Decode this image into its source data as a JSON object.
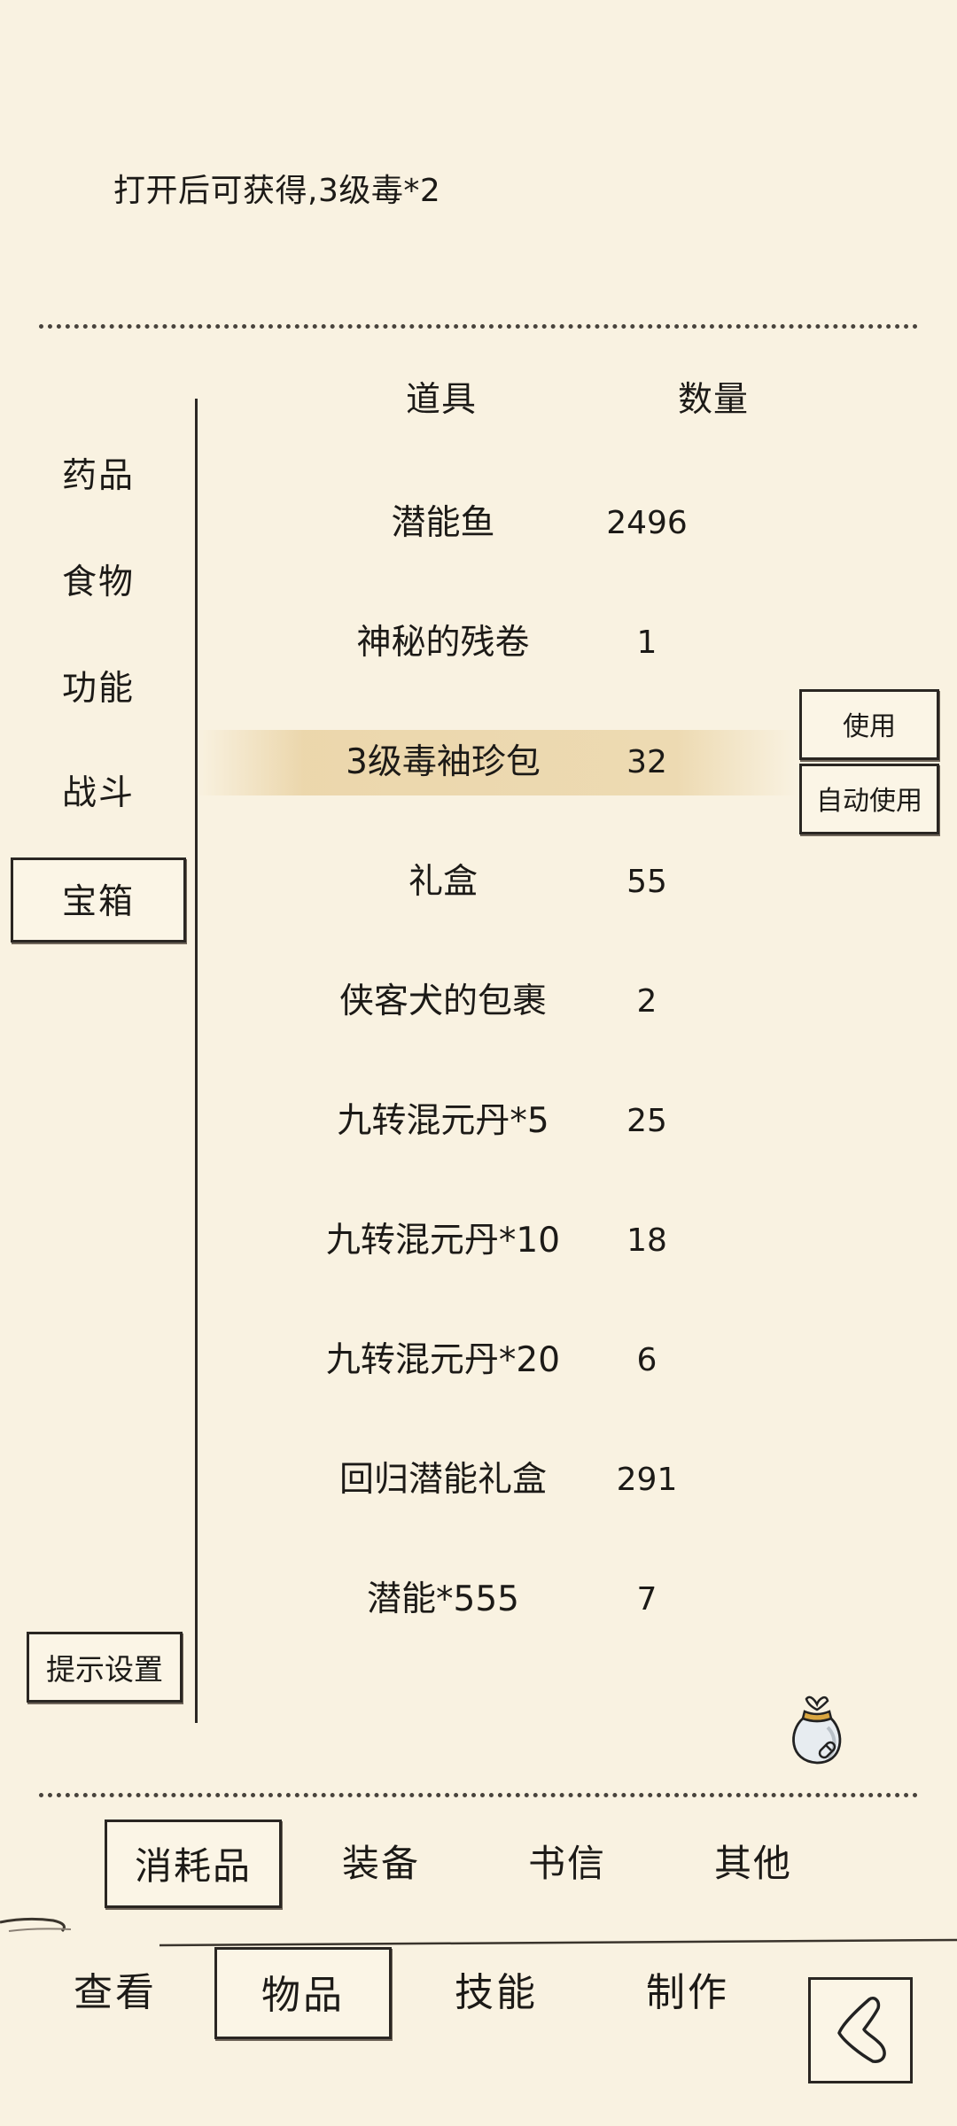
{
  "description": "打开后可获得,3级毒*2",
  "categories": [
    {
      "label": "药品"
    },
    {
      "label": "食物"
    },
    {
      "label": "功能"
    },
    {
      "label": "战斗"
    },
    {
      "label": "宝箱"
    }
  ],
  "selected_category": "宝箱",
  "hint_settings_label": "提示设置",
  "table": {
    "header_item": "道具",
    "header_qty": "数量",
    "rows": [
      {
        "name": "潜能鱼",
        "qty": "2496"
      },
      {
        "name": "神秘的残卷",
        "qty": "1"
      },
      {
        "name": "3级毒袖珍包",
        "qty": "32"
      },
      {
        "name": "礼盒",
        "qty": "55"
      },
      {
        "name": "侠客犬的包裹",
        "qty": "2"
      },
      {
        "name": "九转混元丹*5",
        "qty": "25"
      },
      {
        "name": "九转混元丹*10",
        "qty": "18"
      },
      {
        "name": "九转混元丹*20",
        "qty": "6"
      },
      {
        "name": "回归潜能礼盒",
        "qty": "291"
      },
      {
        "name": "潜能*555",
        "qty": "7"
      }
    ],
    "selected_row": "3级毒袖珍包"
  },
  "actions": {
    "use_label": "使用",
    "auto_use_label": "自动使用"
  },
  "icons": {
    "bag": "bag-icon",
    "back": "back-icon"
  },
  "sub_tabs": [
    {
      "label": "消耗品"
    },
    {
      "label": "装备"
    },
    {
      "label": "书信"
    },
    {
      "label": "其他"
    }
  ],
  "selected_sub_tab": "消耗品",
  "bottom_nav": [
    {
      "label": "查看"
    },
    {
      "label": "物品"
    },
    {
      "label": "技能"
    },
    {
      "label": "制作"
    }
  ],
  "selected_nav": "物品",
  "colors": {
    "background": "#f9f2e1",
    "ink": "#1c1a17",
    "highlight": "#e9d3a6"
  }
}
